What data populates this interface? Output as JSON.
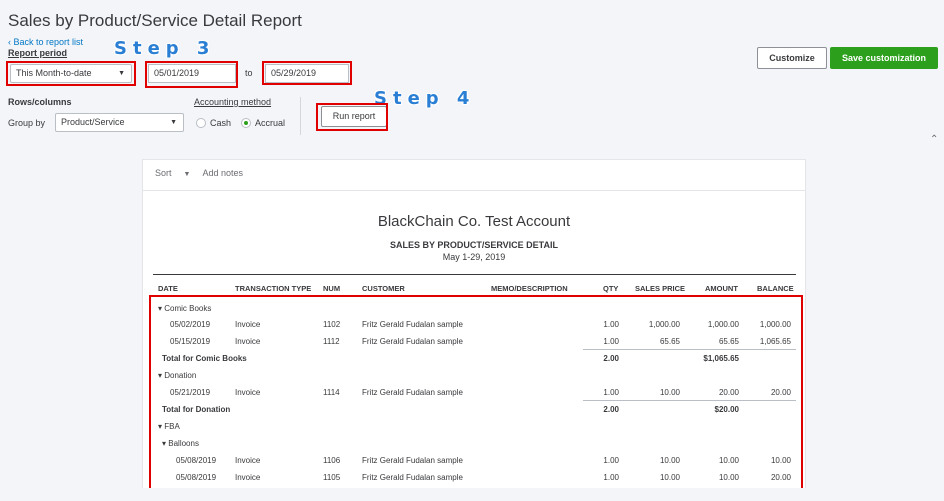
{
  "header": {
    "title": "Sales by Product/Service Detail Report",
    "back_link": "Back to report list",
    "report_period_label": "Report period",
    "period_select": "This Month-to-date",
    "start_date": "05/01/2019",
    "to_label": "to",
    "end_date": "05/29/2019",
    "rows_columns_label": "Rows/columns",
    "group_by_label": "Group by",
    "group_by_select": "Product/Service",
    "accounting_method_label": "Accounting method",
    "cash_label": "Cash",
    "accrual_label": "Accrual",
    "run_report": "Run report",
    "customize": "Customize",
    "save_customization": "Save customization",
    "step3": "Step 3",
    "step4": "Step 4"
  },
  "colors": {
    "green": "#2ca01c",
    "link": "#0077c5",
    "annotation_red": "#e00000",
    "step_blue": "#2a7fd4"
  },
  "report": {
    "toolbar": {
      "sort": "Sort",
      "add_notes": "Add notes"
    },
    "company": "BlackChain Co. Test Account",
    "title": "SALES BY PRODUCT/SERVICE DETAIL",
    "date_range": "May 1-29, 2019",
    "columns": [
      "DATE",
      "TRANSACTION TYPE",
      "NUM",
      "CUSTOMER",
      "MEMO/DESCRIPTION",
      "QTY",
      "SALES PRICE",
      "AMOUNT",
      "BALANCE"
    ],
    "rows": {
      "g1": "Comic Books",
      "r1": [
        "05/02/2019",
        "Invoice",
        "1102",
        "Fritz Gerald Fudalan sample",
        "1.00",
        "1,000.00",
        "1,000.00",
        "1,000.00"
      ],
      "r2": [
        "05/15/2019",
        "Invoice",
        "1112",
        "Fritz Gerald Fudalan sample",
        "1.00",
        "65.65",
        "65.65",
        "1,065.65"
      ],
      "t1": [
        "Total for Comic Books",
        "2.00",
        "$1,065.65"
      ],
      "g2": "Donation",
      "r3": [
        "05/21/2019",
        "Invoice",
        "1114",
        "Fritz Gerald Fudalan sample",
        "1.00",
        "10.00",
        "20.00",
        "20.00"
      ],
      "t2": [
        "Total for Donation",
        "2.00",
        "$20.00"
      ],
      "g3": "FBA",
      "g4": "Balloons",
      "r4": [
        "05/08/2019",
        "Invoice",
        "1106",
        "Fritz Gerald Fudalan sample",
        "1.00",
        "10.00",
        "10.00",
        "10.00"
      ],
      "r5": [
        "05/08/2019",
        "Invoice",
        "1105",
        "Fritz Gerald Fudalan sample",
        "1.00",
        "10.00",
        "10.00",
        "20.00"
      ]
    }
  }
}
